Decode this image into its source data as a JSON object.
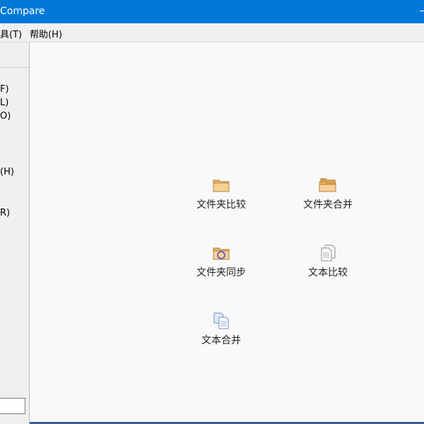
{
  "window": {
    "title": "Compare"
  },
  "menubar": {
    "items": [
      "具(T)",
      "帮助(H)"
    ]
  },
  "sidebar": {
    "items": [
      "F)",
      "L)",
      "O)",
      "(H)",
      "R)"
    ]
  },
  "main": {
    "actions": [
      {
        "label": "文件夹比较",
        "icon": "folder-icon"
      },
      {
        "label": "文件夹合并",
        "icon": "folder-double-icon"
      },
      {
        "label": "文件夹同步",
        "icon": "folder-sync-icon"
      },
      {
        "label": "文本比较",
        "icon": "document-compare-icon"
      },
      {
        "label": "文本合并",
        "icon": "document-merge-icon"
      }
    ]
  },
  "colors": {
    "titlebar": "#0078d7",
    "folder": "#f2c27a",
    "sync": "#7b52b8"
  }
}
